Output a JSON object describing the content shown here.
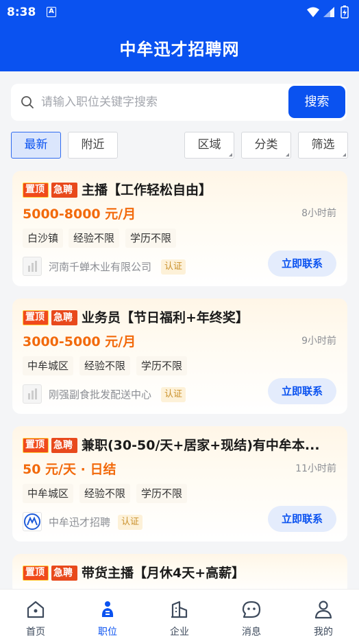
{
  "status_bar": {
    "time": "8:38",
    "keyboard_badge": "A"
  },
  "header": {
    "title": "中牟迅才招聘网"
  },
  "search": {
    "placeholder": "请输入职位关键字搜索",
    "button_label": "搜索"
  },
  "filters": {
    "sort_latest": "最新",
    "sort_nearby": "附近",
    "region": "区域",
    "category": "分类",
    "filter": "筛选"
  },
  "jobs": [
    {
      "badge_top": "置顶",
      "badge_urgent": "急聘",
      "title": "主播【工作轻松自由】",
      "salary": "5000-8000 元/月",
      "posted": "8小时前",
      "tags": [
        "白沙镇",
        "经验不限",
        "学历不限"
      ],
      "company": "河南千蝉木业有限公司",
      "verified": "认证",
      "contact_label": "立即联系"
    },
    {
      "badge_top": "置顶",
      "badge_urgent": "急聘",
      "title": "业务员【节日福利+年终奖】",
      "salary": "3000-5000 元/月",
      "posted": "9小时前",
      "tags": [
        "中牟城区",
        "经验不限",
        "学历不限"
      ],
      "company": "刚强副食批发配送中心",
      "verified": "认证",
      "contact_label": "立即联系"
    },
    {
      "badge_top": "置顶",
      "badge_urgent": "急聘",
      "title": "兼职(30-50/天+居家+现结)有中牟本...",
      "salary": "50 元/天 · 日结",
      "posted": "11小时前",
      "tags": [
        "中牟城区",
        "经验不限",
        "学历不限"
      ],
      "company": "中牟迅才招聘",
      "verified": "认证",
      "contact_label": "立即联系"
    },
    {
      "badge_top": "置顶",
      "badge_urgent": "急聘",
      "title": "带货主播【月休4天+高薪】"
    }
  ],
  "tabbar": {
    "home": "首页",
    "jobs": "职位",
    "company": "企业",
    "messages": "消息",
    "mine": "我的"
  },
  "colors": {
    "primary": "#0a52f0",
    "salary": "#f26a0c",
    "badge_red": "#f04a1c",
    "verified": "#c9902a"
  }
}
